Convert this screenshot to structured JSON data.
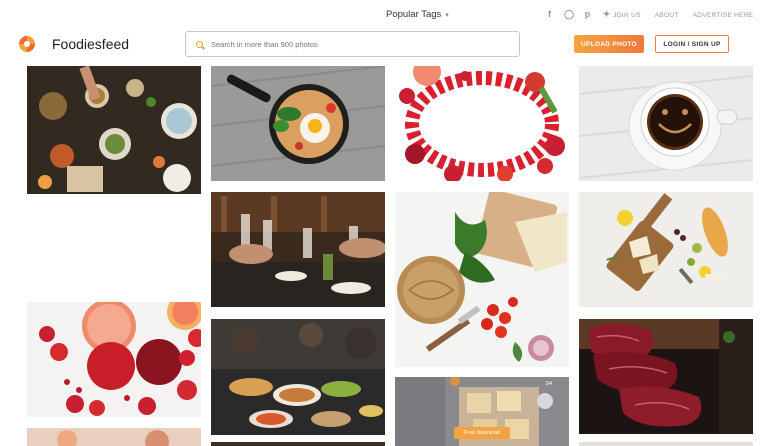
{
  "header": {
    "popular_tags": "Popular Tags",
    "links": [
      "JOIN US",
      "ABOUT",
      "ADVERTISE HERE"
    ],
    "social_icons": [
      "facebook-icon",
      "instagram-icon",
      "pinterest-icon",
      "twitter-icon"
    ],
    "logo_text": "Foodiesfeed",
    "search_placeholder": "Search in more than 900 photos",
    "upload_label": "UPLOAD PHOTO",
    "login_label": "LOGIN / SIGN UP"
  },
  "gallery": {
    "free_download_label": "Free download",
    "badge_count": "54"
  },
  "colors": {
    "accent": "#f5a341",
    "accent_dark": "#ef7a3b"
  }
}
